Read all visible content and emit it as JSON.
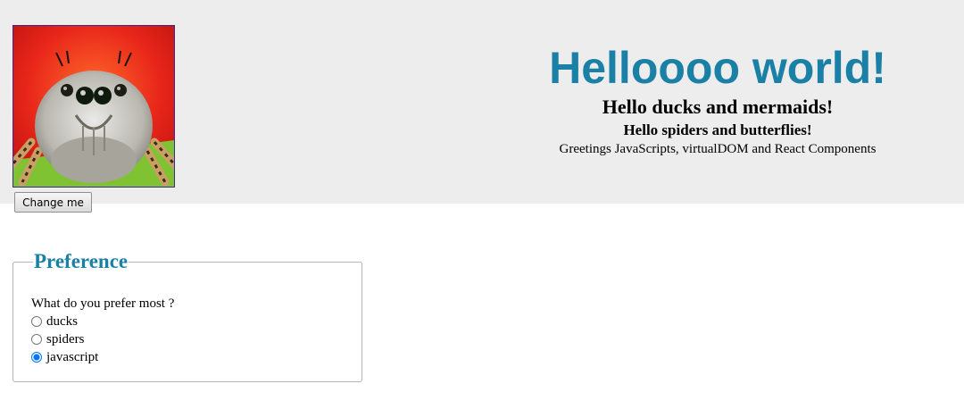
{
  "header": {
    "title": "Helloooo world!",
    "subtitle": "Hello ducks and mermaids!",
    "subsubtitle": "Hello spiders and butterflies!",
    "tagline": "Greetings JavaScripts, virtualDOM and React Components",
    "change_button_label": "Change me",
    "avatar_icon": "jumping-spider-photo"
  },
  "preference": {
    "legend": "Preference",
    "question": "What do you prefer most ?",
    "options": [
      {
        "label": "ducks",
        "checked": false
      },
      {
        "label": "spiders",
        "checked": false
      },
      {
        "label": "javascript",
        "checked": true
      }
    ]
  },
  "colors": {
    "accent": "#1a80a6",
    "header_bg": "#ededed"
  }
}
